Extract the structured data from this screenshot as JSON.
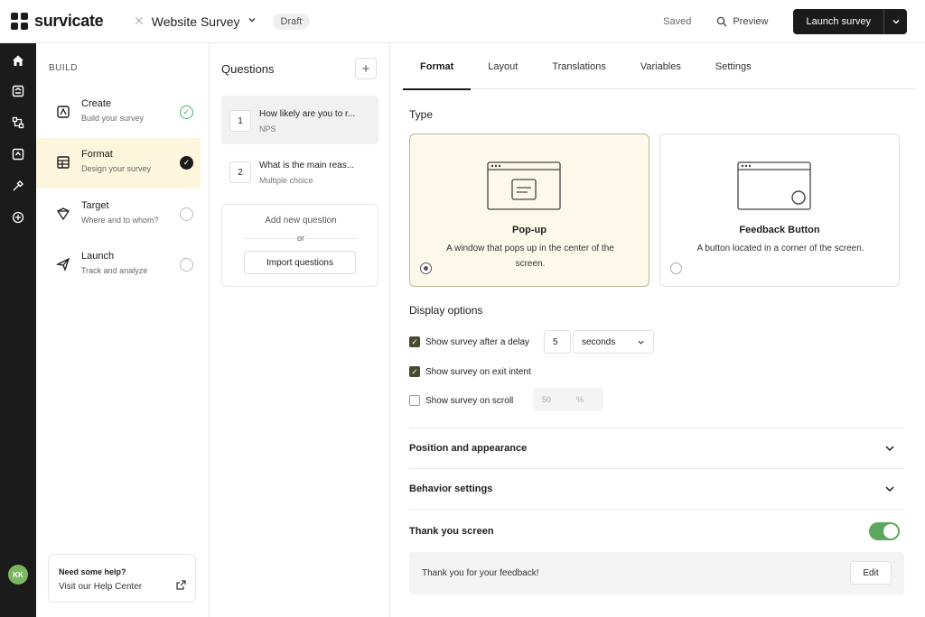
{
  "header": {
    "brand": "survicate",
    "survey_title": "Website Survey",
    "status_badge": "Draft",
    "saved_label": "Saved",
    "preview_label": "Preview",
    "launch_label": "Launch survey"
  },
  "rail": {
    "icons": [
      "home-icon",
      "survey-icon",
      "integrations-icon",
      "build-icon",
      "tools-icon",
      "add-circle-icon"
    ],
    "avatar_initials": "KK"
  },
  "build": {
    "title": "BUILD",
    "steps": [
      {
        "name": "Create",
        "sub": "Build your survey",
        "status": "done"
      },
      {
        "name": "Format",
        "sub": "Design your survey",
        "status": "current"
      },
      {
        "name": "Target",
        "sub": "Where and to whom?",
        "status": "todo"
      },
      {
        "name": "Launch",
        "sub": "Track and analyze",
        "status": "todo"
      }
    ],
    "help": {
      "title": "Need some help?",
      "link": "Visit our Help Center"
    }
  },
  "questions": {
    "title": "Questions",
    "items": [
      {
        "num": "1",
        "text": "How likely are you to r...",
        "type": "NPS"
      },
      {
        "num": "2",
        "text": "What is the main reas...",
        "type": "Multiple choice"
      }
    ],
    "add_new": "Add new question",
    "or": "or",
    "import": "Import questions"
  },
  "main": {
    "tabs": [
      "Format",
      "Layout",
      "Translations",
      "Variables",
      "Settings"
    ],
    "active_tab": "Format",
    "type_title": "Type",
    "types": [
      {
        "name": "Pop-up",
        "desc": "A window that pops up in the center of the screen.",
        "selected": true
      },
      {
        "name": "Feedback Button",
        "desc": "A button located in a corner of the screen.",
        "selected": false
      }
    ],
    "display_title": "Display options",
    "options": {
      "delay_label": "Show survey after a delay",
      "delay_value": "5",
      "delay_unit": "seconds",
      "exit_label": "Show survey on exit intent",
      "scroll_label": "Show survey on scroll",
      "scroll_value": "50",
      "scroll_unit": "%"
    },
    "accordions": [
      "Position and appearance",
      "Behavior settings"
    ],
    "thank_you": {
      "title": "Thank you screen",
      "enabled": true,
      "text": "Thank you for your feedback!",
      "edit": "Edit"
    }
  },
  "colors": {
    "accent_dark": "#1b1b1b",
    "active_step_bg": "#fcf6dd",
    "success": "#4caf68",
    "toggle_on": "#5da65d"
  }
}
